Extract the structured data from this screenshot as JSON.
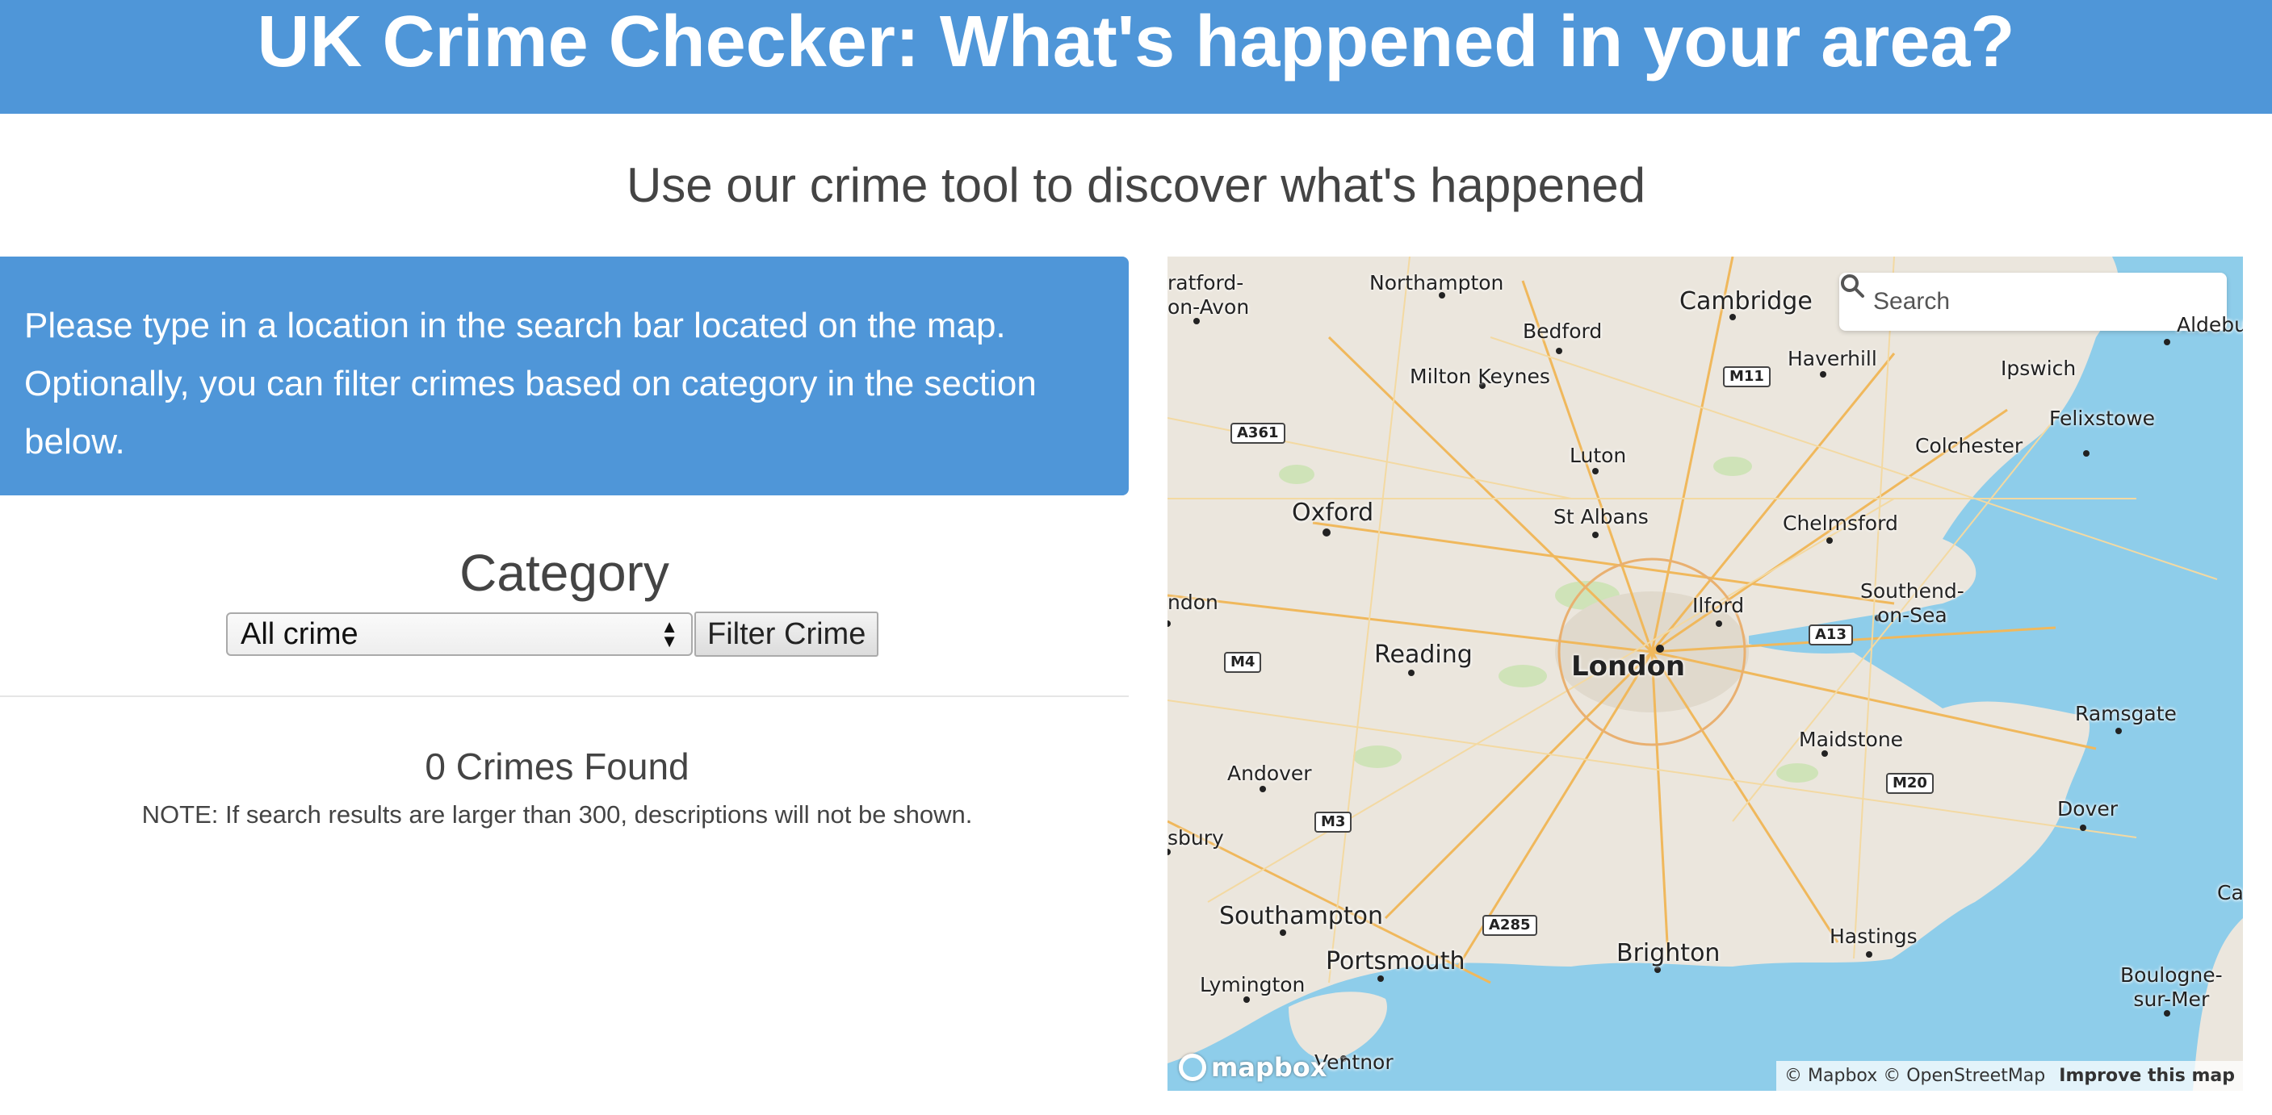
{
  "header": {
    "title": "UK Crime Checker: What's happened in your area?"
  },
  "subtitle": "Use our crime tool to discover what's happened",
  "info_panel": {
    "text": "Please type in a location in the search bar located on the map. Optionally, you can filter crimes based on category in the section below."
  },
  "filter": {
    "title": "Category",
    "select_value": "All crime",
    "button_label": "Filter Crime"
  },
  "results": {
    "count_text": "0 Crimes Found",
    "note": "NOTE: If search results are larger than 300, descriptions will not be shown."
  },
  "map": {
    "search_placeholder": "Search",
    "search_icon": "search-icon",
    "logo_text": "mapbox",
    "attribution": "© Mapbox © OpenStreetMap",
    "improve_link": "Improve this map",
    "colors": {
      "land": "#ebe6dd",
      "water": "#8ecdea",
      "roads": "#f2c46b"
    },
    "places": {
      "stratford": "ratford-\non-Avon",
      "northampton": "Northampton",
      "cambridge": "Cambridge",
      "bedford": "Bedford",
      "haverhill": "Haverhill",
      "ipswich": "Ipswich",
      "aldeburgh": "Aldeburgh",
      "milton_keynes": "Milton Keynes",
      "felixstowe": "Felixstowe",
      "colchester": "Colchester",
      "luton": "Luton",
      "oxford": "Oxford",
      "st_albans": "St Albans",
      "chelmsford": "Chelmsford",
      "london_w": "ndon",
      "ilford": "Ilford",
      "southend": "Southend-\non-Sea",
      "reading": "Reading",
      "london": "London",
      "ramsgate": "Ramsgate",
      "maidstone": "Maidstone",
      "andover": "Andover",
      "dover": "Dover",
      "salisbury": "sbury",
      "southampton": "Southampton",
      "portsmouth": "Portsmouth",
      "brighton": "Brighton",
      "hastings": "Hastings",
      "lymington": "Lymington",
      "boulogne": "Boulogne-\nsur-Mer",
      "ventnor": "Ventnor",
      "calais": "Ca"
    },
    "roads": {
      "a361": "A361",
      "m11": "M11",
      "a13": "A13",
      "m4": "M4",
      "m20": "M20",
      "m3": "M3",
      "a285": "A285"
    }
  }
}
